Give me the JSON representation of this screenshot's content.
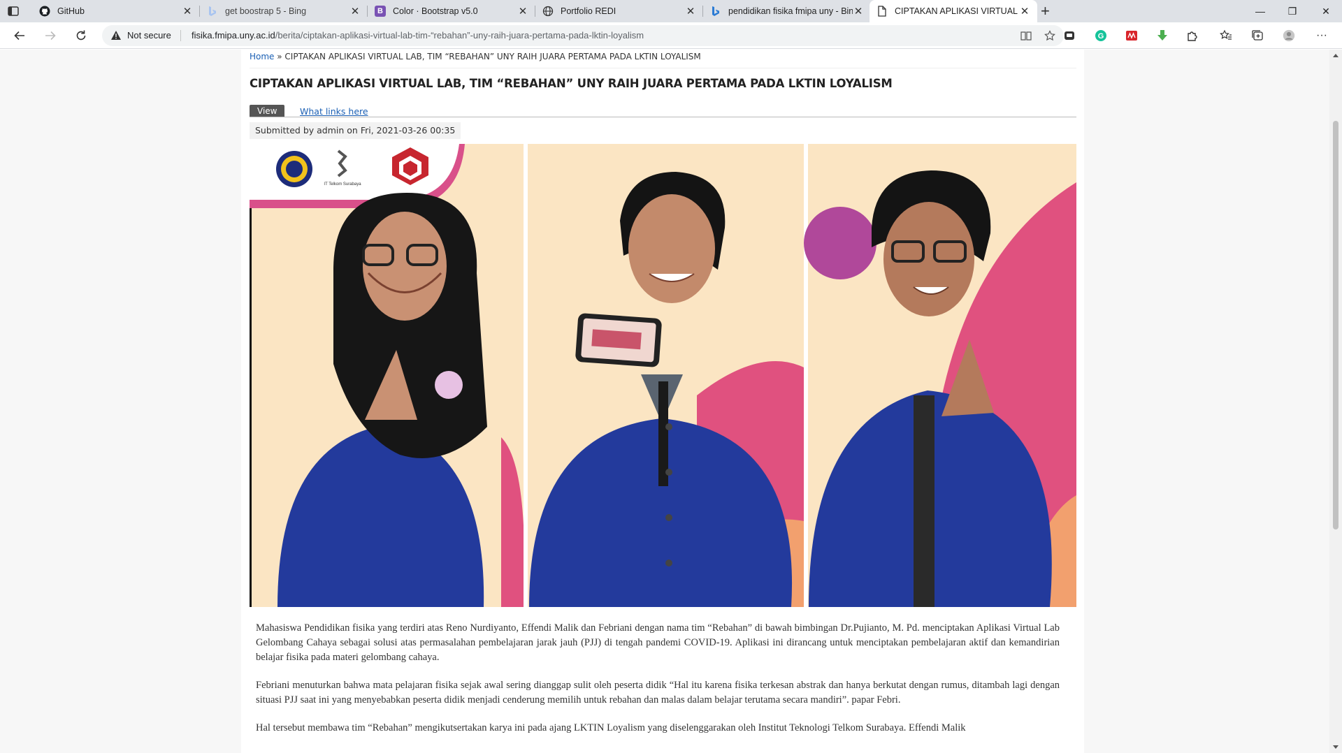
{
  "browser": {
    "tabs": [
      {
        "title": "GitHub",
        "icon": "github-icon"
      },
      {
        "title": "get boostrap 5 - Bing",
        "icon": "bing-icon"
      },
      {
        "title": "Color · Bootstrap v5.0",
        "icon": "bootstrap-icon"
      },
      {
        "title": "Portfolio REDI",
        "icon": "globe-icon"
      },
      {
        "title": "pendidikan fisika fmipa uny - Bin",
        "icon": "bing-icon"
      },
      {
        "title": "CIPTAKAN APLIKASI VIRTUAL LA",
        "icon": "page-icon"
      }
    ],
    "security_label": "Not secure",
    "url_domain": "fisika.fmipa.uny.ac.id",
    "url_path": "/berita/ciptakan-aplikasi-virtual-lab-tim-“rebahan”-uny-raih-juara-pertama-pada-lktin-loyalism",
    "bootstrap_badge": "B"
  },
  "page": {
    "breadcrumb_home": "Home",
    "breadcrumb_sep": " » ",
    "breadcrumb_current": "CIPTAKAN APLIKASI VIRTUAL LAB, TIM “REBAHAN” UNY RAIH JUARA PERTAMA PADA LKTIN LOYALISM",
    "title": "CIPTAKAN APLIKASI VIRTUAL LAB, TIM “REBAHAN” UNY RAIH JUARA PERTAMA PADA LKTIN LOYALISM",
    "tab_view": "View",
    "tab_links": "What links here",
    "submitted": "Submitted by admin on Fri, 2021-03-26 00:35",
    "photo_logo_text": "IT Telkom Surabaya",
    "paragraphs": [
      "Mahasiswa Pendidikan fisika yang terdiri atas Reno Nurdiyanto, Effendi Malik dan Febriani dengan nama tim “Rebahan” di bawah bimbingan Dr.Pujianto, M. Pd. menciptakan Aplikasi Virtual Lab Gelombang Cahaya sebagai solusi atas permasalahan pembelajaran jarak jauh (PJJ) di tengah pandemi COVID-19. Aplikasi ini dirancang untuk menciptakan pembelajaran aktif dan kemandirian belajar fisika pada materi gelombang cahaya.",
      "Febriani menuturkan bahwa mata pelajaran fisika sejak awal sering dianggap sulit oleh peserta didik “Hal itu karena fisika terkesan abstrak dan hanya berkutat dengan rumus, ditambah lagi dengan situasi PJJ saat ini yang menyebabkan peserta didik menjadi cenderung memilih untuk rebahan dan malas dalam belajar terutama secara mandiri”. papar Febri.",
      "Hal tersebut  membawa tim “Rebahan” mengikutsertakan karya ini pada ajang LKTIN Loyalism yang diselenggarakan oleh Institut Teknologi Telkom Surabaya. Effendi Malik"
    ]
  },
  "colors": {
    "jacket": "#233a9c",
    "backdrop": "#fbe5c3",
    "accent_pink": "#e0517f",
    "accent_purple": "#b0489a"
  }
}
